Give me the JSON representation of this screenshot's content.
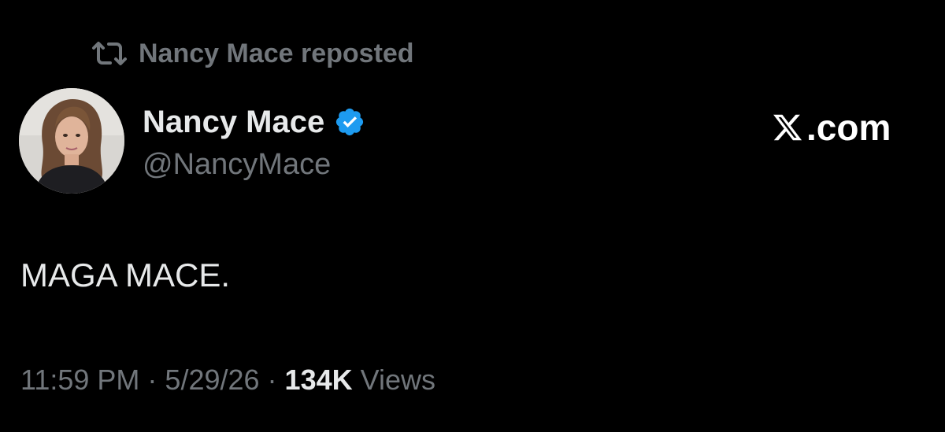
{
  "repost": {
    "icon": "repost-icon",
    "text": "Nancy Mace reposted"
  },
  "author": {
    "display_name": "Nancy Mace",
    "handle": "@NancyMace",
    "verified_icon": "verified-badge-icon",
    "verified_color": "#1d9bf0"
  },
  "brand": {
    "icon": "x-logo-icon",
    "text": ".com"
  },
  "tweet": {
    "text": "MAGA MACE."
  },
  "meta": {
    "time": "11:59 PM",
    "separator": "·",
    "date": "5/29/26",
    "views_count": "134K",
    "views_label": "Views"
  },
  "colors": {
    "background": "#000000",
    "primary_text": "#e7e9ea",
    "secondary_text": "#71767b",
    "accent": "#1d9bf0"
  }
}
